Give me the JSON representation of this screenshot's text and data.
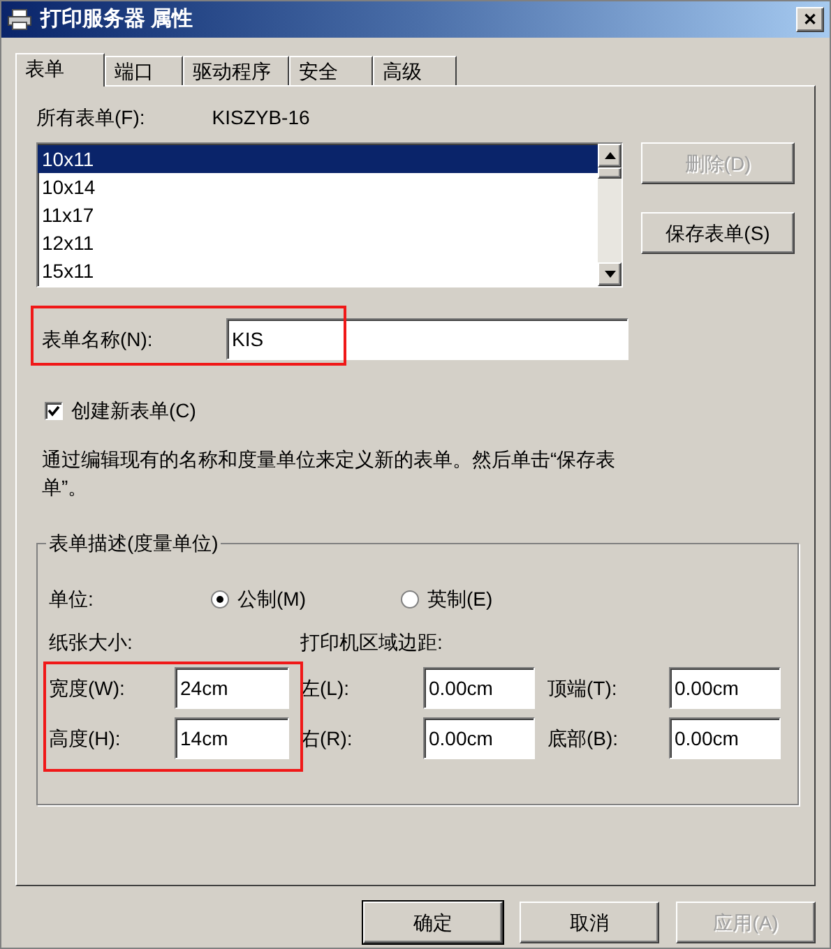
{
  "window": {
    "title": "打印服务器 属性",
    "close": "✕"
  },
  "tabs": [
    {
      "label": "表单",
      "selected": true
    },
    {
      "label": "端口",
      "selected": false
    },
    {
      "label": "驱动程序",
      "selected": false
    },
    {
      "label": "安全",
      "selected": false
    },
    {
      "label": "高级",
      "selected": false
    }
  ],
  "all_forms": {
    "label": "所有表单(F):",
    "value": "KISZYB-16"
  },
  "forms_list": [
    {
      "label": "10x11",
      "selected": true
    },
    {
      "label": "10x14",
      "selected": false
    },
    {
      "label": "11x17",
      "selected": false
    },
    {
      "label": "12x11",
      "selected": false
    },
    {
      "label": "15x11",
      "selected": false
    }
  ],
  "side_buttons": [
    {
      "label": "删除(D)",
      "disabled": true
    },
    {
      "label": "保存表单(S)",
      "disabled": false
    }
  ],
  "form_name": {
    "label": "表单名称(N):",
    "value": "KIS",
    "highlighted": true
  },
  "create_new": {
    "label": "创建新表单(C)",
    "checked": true
  },
  "description": "通过编辑现有的名称和度量单位来定义新的表单。然后单击“保存表单”。",
  "group": {
    "title": "表单描述(度量单位)",
    "units_label": "单位:",
    "units": [
      {
        "label": "公制(M)",
        "selected": true
      },
      {
        "label": "英制(E)",
        "selected": false
      }
    ],
    "paper_size": {
      "label": "纸张大小:",
      "highlighted": true,
      "fields": [
        {
          "label": "宽度(W):",
          "value": "24cm"
        },
        {
          "label": "高度(H):",
          "value": "14cm"
        }
      ]
    },
    "margins": {
      "label": "打印机区域边距:",
      "fields": [
        {
          "label": "左(L):",
          "value": "0.00cm"
        },
        {
          "label": "顶端(T):",
          "value": "0.00cm"
        },
        {
          "label": "右(R):",
          "value": "0.00cm"
        },
        {
          "label": "底部(B):",
          "value": "0.00cm"
        }
      ]
    }
  },
  "buttons": [
    {
      "label": "确定",
      "disabled": false,
      "default": true
    },
    {
      "label": "取消",
      "disabled": false,
      "default": false
    },
    {
      "label": "应用(A)",
      "disabled": true,
      "default": false
    }
  ]
}
